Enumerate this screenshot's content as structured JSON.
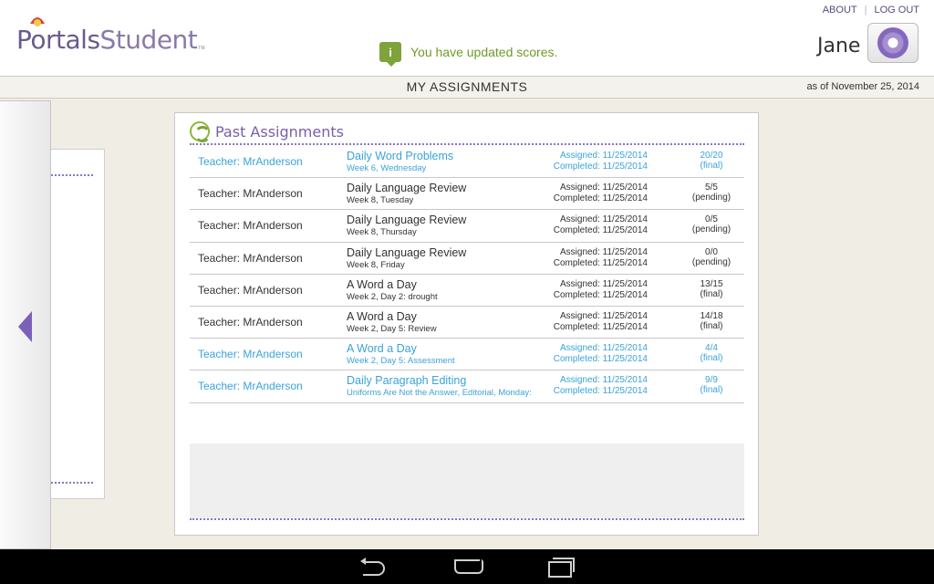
{
  "header": {
    "logo_prefix": "Portals",
    "logo_suffix": "Student",
    "logo_tm": "TM",
    "notice": "You have updated scores.",
    "about": "ABOUT",
    "separator": "|",
    "logout": "LOG OUT",
    "username": "Jane"
  },
  "titlebar": {
    "title": "MY ASSIGNMENTS",
    "as_of": "as of November 25, 2014"
  },
  "card": {
    "title": "Past Assignments"
  },
  "rows": [
    {
      "teacher": "Teacher: MrAnderson",
      "name": "Daily Word Problems",
      "sub": "Week 6, Wednesday",
      "assigned": "Assigned: 11/25/2014",
      "completed": "Completed: 11/25/2014",
      "score": "20/20",
      "status": "(final)"
    },
    {
      "teacher": "Teacher: MrAnderson",
      "name": "Daily Language Review",
      "sub": "Week 8, Tuesday",
      "assigned": "Assigned: 11/25/2014",
      "completed": "Completed: 11/25/2014",
      "score": "5/5",
      "status": "(pending)"
    },
    {
      "teacher": "Teacher: MrAnderson",
      "name": "Daily Language Review",
      "sub": "Week 8, Thursday",
      "assigned": "Assigned: 11/25/2014",
      "completed": "Completed: 11/25/2014",
      "score": "0/5",
      "status": "(pending)"
    },
    {
      "teacher": "Teacher: MrAnderson",
      "name": "Daily Language Review",
      "sub": "Week 8, Friday",
      "assigned": "Assigned: 11/25/2014",
      "completed": "Completed: 11/25/2014",
      "score": "0/0",
      "status": "(pending)"
    },
    {
      "teacher": "Teacher: MrAnderson",
      "name": "A Word a Day",
      "sub": "Week 2, Day 2: drought",
      "assigned": "Assigned: 11/25/2014",
      "completed": "Completed: 11/25/2014",
      "score": "13/15",
      "status": "(final)"
    },
    {
      "teacher": "Teacher: MrAnderson",
      "name": "A Word a Day",
      "sub": "Week 2, Day 5: Review",
      "assigned": "Assigned: 11/25/2014",
      "completed": "Completed: 11/25/2014",
      "score": "14/18",
      "status": "(final)"
    },
    {
      "teacher": "Teacher: MrAnderson",
      "name": "A Word a Day",
      "sub": "Week 2, Day 5: Assessment",
      "assigned": "Assigned: 11/25/2014",
      "completed": "Completed: 11/25/2014",
      "score": "4/4",
      "status": "(final)"
    },
    {
      "teacher": "Teacher: MrAnderson",
      "name": "Daily Paragraph Editing",
      "sub": "Uniforms Are Not the Answer, Editorial, Monday:",
      "assigned": "Assigned: 11/25/2014",
      "completed": "Completed: 11/25/2014",
      "score": "9/9",
      "status": "(final)"
    }
  ],
  "colors": {
    "accent_purple": "#7a5fa8",
    "link_blue": "#3ba3d6",
    "notice_green": "#6f9a2a"
  },
  "icons": {
    "logo": "portals-logo-icon",
    "notice": "info-icon",
    "settings": "gear-icon",
    "refresh": "refresh-icon",
    "collapse": "chevron-left-icon"
  }
}
